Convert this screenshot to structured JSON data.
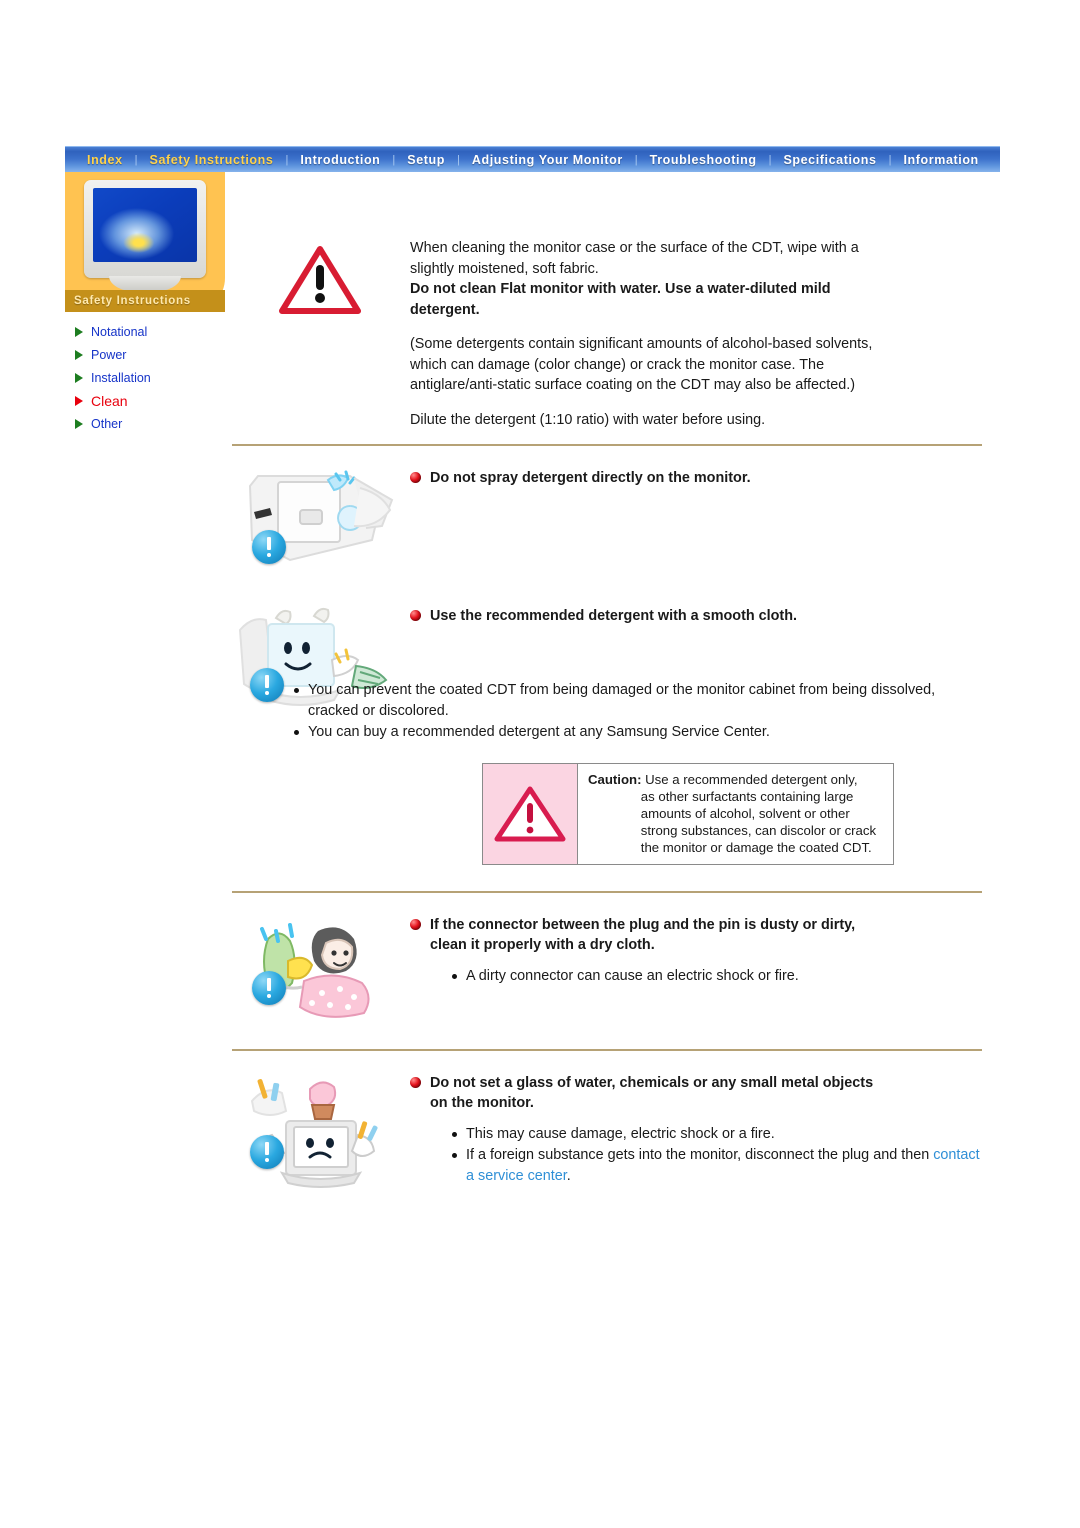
{
  "nav": {
    "items": [
      {
        "label": "Index",
        "active": false
      },
      {
        "label": "Safety Instructions",
        "active": true
      },
      {
        "label": "Introduction",
        "active": false
      },
      {
        "label": "Setup",
        "active": false
      },
      {
        "label": "Adjusting Your Monitor",
        "active": false
      },
      {
        "label": "Troubleshooting",
        "active": false
      },
      {
        "label": "Specifications",
        "active": false
      },
      {
        "label": "Information",
        "active": false
      }
    ],
    "separator": "|"
  },
  "sidebar": {
    "caption": "Safety Instructions",
    "items": [
      {
        "label": "Notational",
        "selected": false
      },
      {
        "label": "Power",
        "selected": false
      },
      {
        "label": "Installation",
        "selected": false
      },
      {
        "label": "Clean",
        "selected": true
      },
      {
        "label": "Other",
        "selected": false
      }
    ]
  },
  "intro": {
    "para1_line1": "When cleaning the monitor case or the surface of the CDT, wipe with a",
    "para1_line2": "slightly moistened, soft fabric.",
    "bold_line1": "Do not clean Flat monitor with water. Use a water-diluted mild",
    "bold_line2": "detergent.",
    "para2_line1": "(Some detergents contain significant amounts of alcohol-based solvents,",
    "para2_line2": "which can damage (color change) or crack the monitor case. The",
    "para2_line3": "antiglare/anti-static surface coating on the CDT may also be affected.)",
    "para3": "Dilute the detergent (1:10 ratio) with water before using."
  },
  "sections": [
    {
      "heading": "Do not spray detergent directly on the monitor.",
      "bullets": [],
      "illustration": "spray-bottle-monitor-illustration"
    },
    {
      "heading": "Use the recommended detergent with a smooth cloth.",
      "bullets": [
        "You can prevent the coated CDT from being damaged or the monitor cabinet from being dissolved, cracked or discolored.",
        "You can buy a recommended detergent at any Samsung Service Center."
      ],
      "illustration": "monitor-with-cloth-illustration"
    },
    {
      "heading_line1": "If the connector between the plug and the pin is dusty or dirty,",
      "heading_line2": "clean it properly with a dry cloth.",
      "bullets": [
        "A dirty connector can cause an electric shock or fire."
      ],
      "illustration": "person-cleaning-plug-illustration"
    },
    {
      "heading_line1": "Do not set a glass of water, chemicals or any small metal objects",
      "heading_line2": "on the monitor.",
      "bullets": [
        "This may cause damage, electric shock or a fire."
      ],
      "bullet_link_prefix": "If a foreign substance gets into the monitor, disconnect the plug and then ",
      "bullet_link_text": "contact a service center",
      "bullet_link_suffix": ".",
      "illustration": "objects-on-monitor-illustration"
    }
  ],
  "caution_box": {
    "label": "Caution:",
    "line1": "Use a recommended detergent only,",
    "line2": "as other surfactants containing large",
    "line3": "amounts of alcohol, solvent or other",
    "line4": "strong substances, can discolor or crack",
    "line5": "the monitor or damage the coated CDT."
  },
  "colors": {
    "nav_blue": "#3d72cc",
    "nav_active": "#ffd24a",
    "sidebar_orange": "#ffc351",
    "sidebar_caption_bg": "#c4901a",
    "link_blue": "#1634c8",
    "selected_red": "#e8000d",
    "divider": "#b6a276",
    "caution_pink": "#fbd5e2",
    "service_link": "#2f8fd6"
  }
}
